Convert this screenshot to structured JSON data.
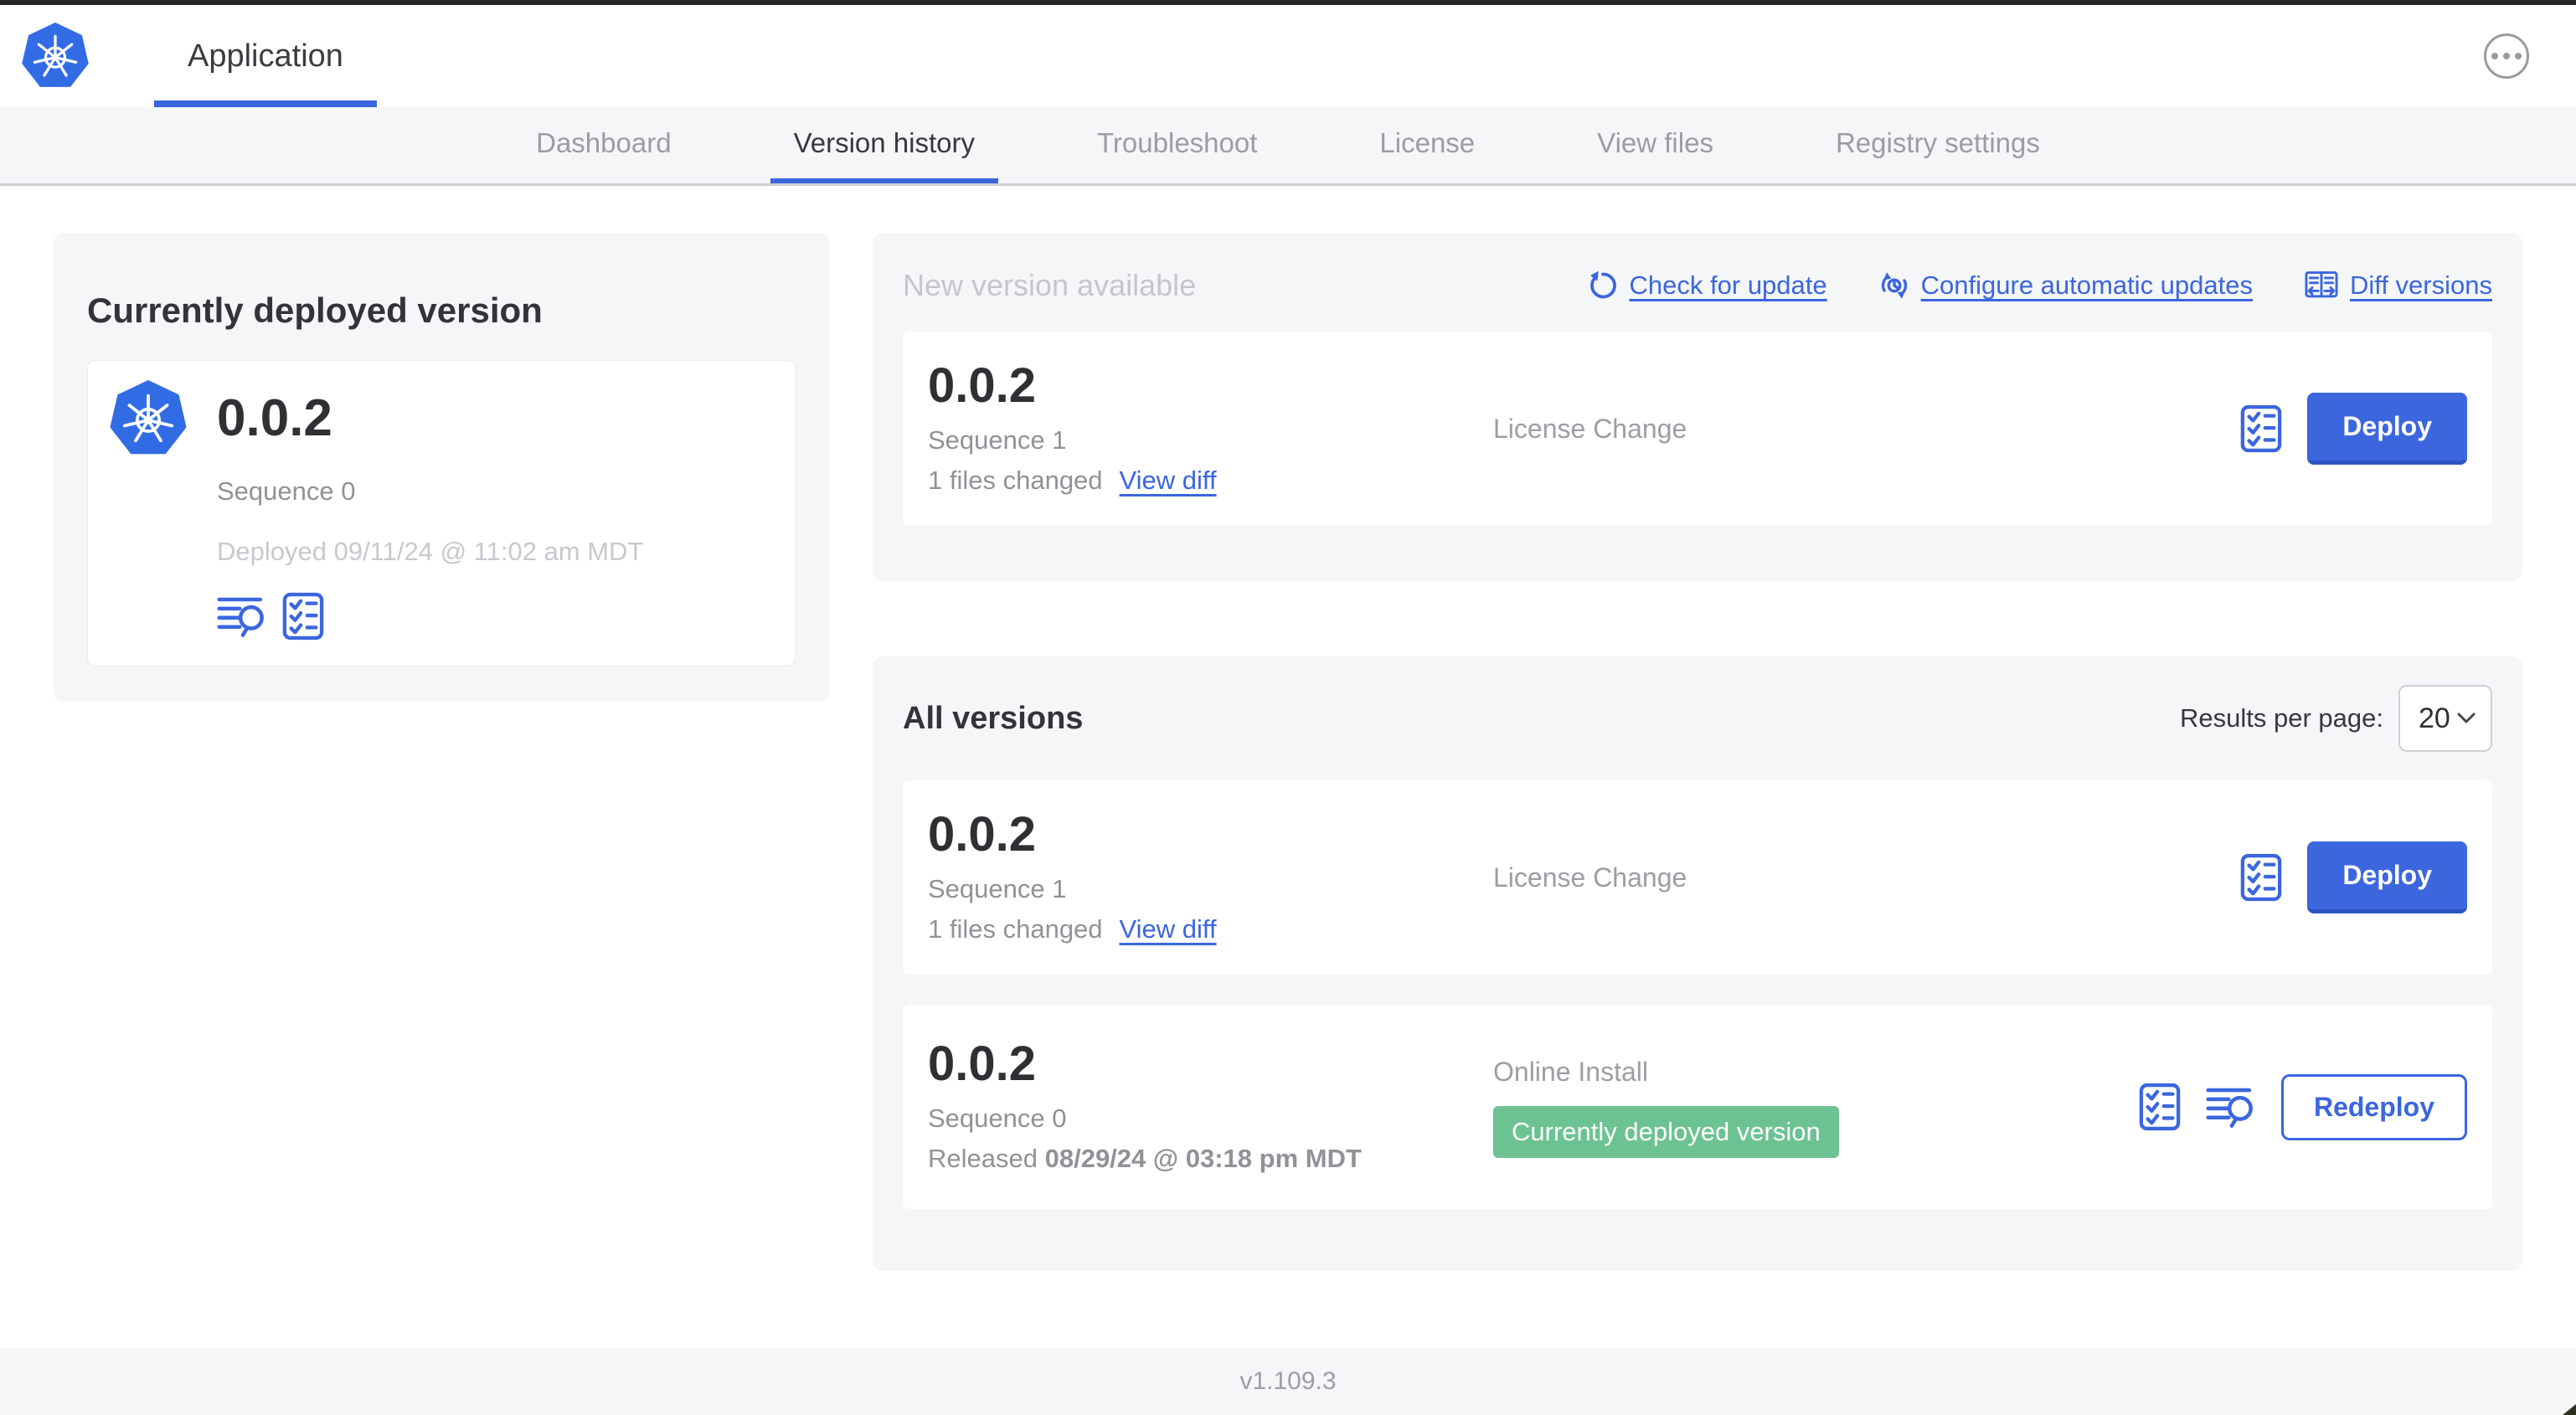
{
  "header": {
    "app_title": "Application"
  },
  "nav": {
    "tabs": [
      {
        "label": "Dashboard"
      },
      {
        "label": "Version history"
      },
      {
        "label": "Troubleshoot"
      },
      {
        "label": "License"
      },
      {
        "label": "View files"
      },
      {
        "label": "Registry settings"
      }
    ]
  },
  "current_version": {
    "title": "Currently deployed version",
    "version": "0.0.2",
    "sequence": "Sequence 0",
    "deployed": "Deployed 09/11/24 @ 11:02 am MDT",
    "icons": [
      "logs-icon",
      "preflight-checklist-icon"
    ]
  },
  "new_version": {
    "title": "New version available",
    "actions": [
      {
        "icon": "refresh-icon",
        "label": "Check for update"
      },
      {
        "icon": "schedule-icon",
        "label": "Configure automatic updates"
      },
      {
        "icon": "diff-icon",
        "label": "Diff versions"
      }
    ],
    "card": {
      "version": "0.0.2",
      "sequence": "Sequence 1",
      "files_changed": "1 files changed",
      "view_diff": "View diff",
      "source": "License Change",
      "action_label": "Deploy"
    }
  },
  "all_versions": {
    "title": "All versions",
    "results_per_page_label": "Results per page:",
    "results_per_page_value": "20",
    "rows": [
      {
        "version": "0.0.2",
        "sequence": "Sequence 1",
        "files_changed": "1 files changed",
        "view_diff": "View diff",
        "source": "License Change",
        "action_label": "Deploy"
      },
      {
        "version": "0.0.2",
        "sequence": "Sequence 0",
        "released_prefix": "Released",
        "released_date": "08/29/24 @ 03:18 pm MDT",
        "source": "Online Install",
        "badge": "Currently deployed version",
        "action_label": "Redeploy"
      }
    ]
  },
  "footer": {
    "app_manager_version": "v1.109.3"
  },
  "colors": {
    "accent_blue": "#3b66de",
    "kubernetes_blue": "#326ce5",
    "badge_green": "#6dc291",
    "panel_bg": "#f5f6f8",
    "muted_text": "#9b9ea2"
  }
}
